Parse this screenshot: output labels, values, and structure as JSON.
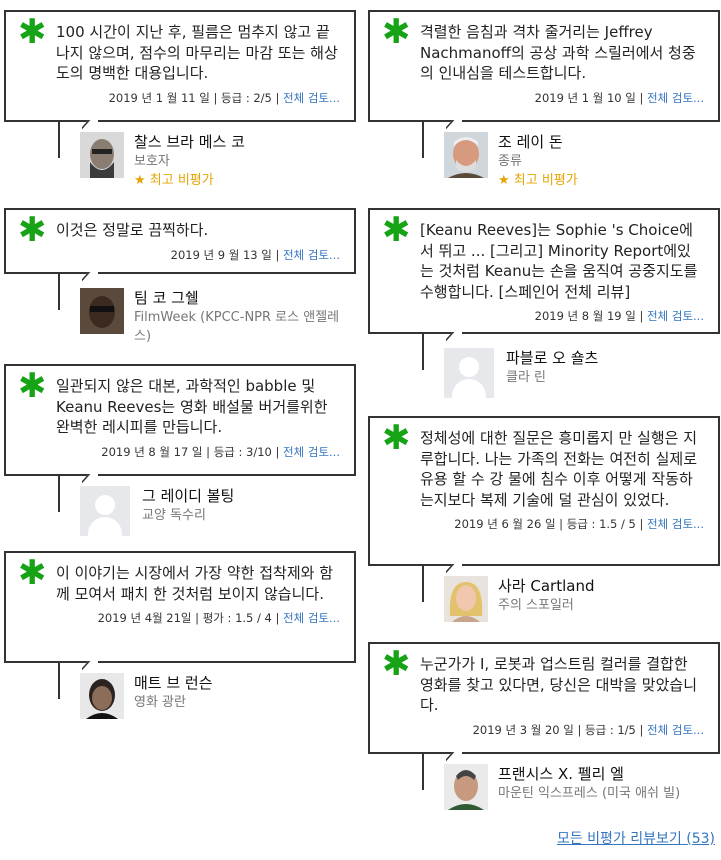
{
  "common": {
    "full_review": "전체 검토..."
  },
  "left": [
    {
      "quote": "100 시간이 지난 후, 필름은 멈추지 않고 끝나지 않으며, 점수의 마무리는 마감 또는 해상도의 명백한 대용입니다.",
      "date": "2019 년 1 월 11 일",
      "rating": "등급 : 2/5",
      "critic": "찰스 브라 메스 코",
      "publication": "보호자",
      "top": "★ 최고 비평가"
    },
    {
      "quote": "이것은 정말로 끔찍하다.",
      "date": "2019 년 9 월 13 일",
      "rating": "",
      "critic": "팀 코 그쉘",
      "publication": "FilmWeek (KPCC-NPR 로스 앤젤레스)",
      "top": ""
    },
    {
      "quote": "일관되지 않은 대본, 과학적인 babble 및 Keanu Reeves는 영화 배설물 버거를위한 완벽한 레시피를 만듭니다.",
      "date": "2019 년 8 월 17 일",
      "rating": "등급 : 3/10",
      "critic": "그 레이디 볼팅",
      "publication": "교양 독수리",
      "top": ""
    },
    {
      "quote": "이 이야기는 시장에서 가장 약한 접착제와 함께 모여서 패치 한 것처럼 보이지 않습니다.",
      "date": "2019 년 4월 21일",
      "rating": "평가 : 1.5 / 4",
      "critic": "매트 브 런슨",
      "publication": "영화 광란",
      "top": ""
    }
  ],
  "right": [
    {
      "quote": "격렬한 음침과 격차 줄거리는 Jeffrey Nachmanoff의 공상 과학 스릴러에서 청중의 인내심을 테스트합니다.",
      "date": "2019 년 1 월 10 일",
      "rating": "",
      "critic": "조 레이 돈",
      "publication": "종류",
      "top": "★ 최고 비평가"
    },
    {
      "quote": "[Keanu Reeves]는 Sophie 's Choice에서 뛰고 ... [그리고] Minority Report에있는 것처럼 Keanu는 손을 움직여 공중지도를 수행합니다. [스페인어 전체 리뷰]",
      "date": "2019 년 8 월 19 일",
      "rating": "",
      "critic": "파블로 오 숄츠",
      "publication": "클라 린",
      "top": ""
    },
    {
      "quote": "정체성에 대한 질문은 흥미롭지 만 실행은 지루합니다. 나는 가족의 전화는 여전히 실제로 유용 할 수 강 물에 침수 이후 어떻게 작동하는지보다 복제 기술에 덜 관심이 있었다.",
      "date": "2019 년 6 월 26 일",
      "rating": "등급 : 1.5 / 5",
      "critic": "사라 Cartland",
      "publication": "주의 스포일러",
      "top": ""
    },
    {
      "quote": "누군가가 I, 로봇과 업스트림 컬러를 결합한 영화를 찾고 있다면, 당신은 대박을 맞았습니다.",
      "date": "2019 년 3 월 20 일",
      "rating": "등급 : 1/5",
      "critic": "프랜시스 X. 펠리 엘",
      "publication": "마운틴 익스프레스 (미국 애쉬 빌)",
      "top": ""
    }
  ],
  "footer": {
    "all_reviews": "모든 비평가 리뷰보기",
    "count": "(53)"
  }
}
